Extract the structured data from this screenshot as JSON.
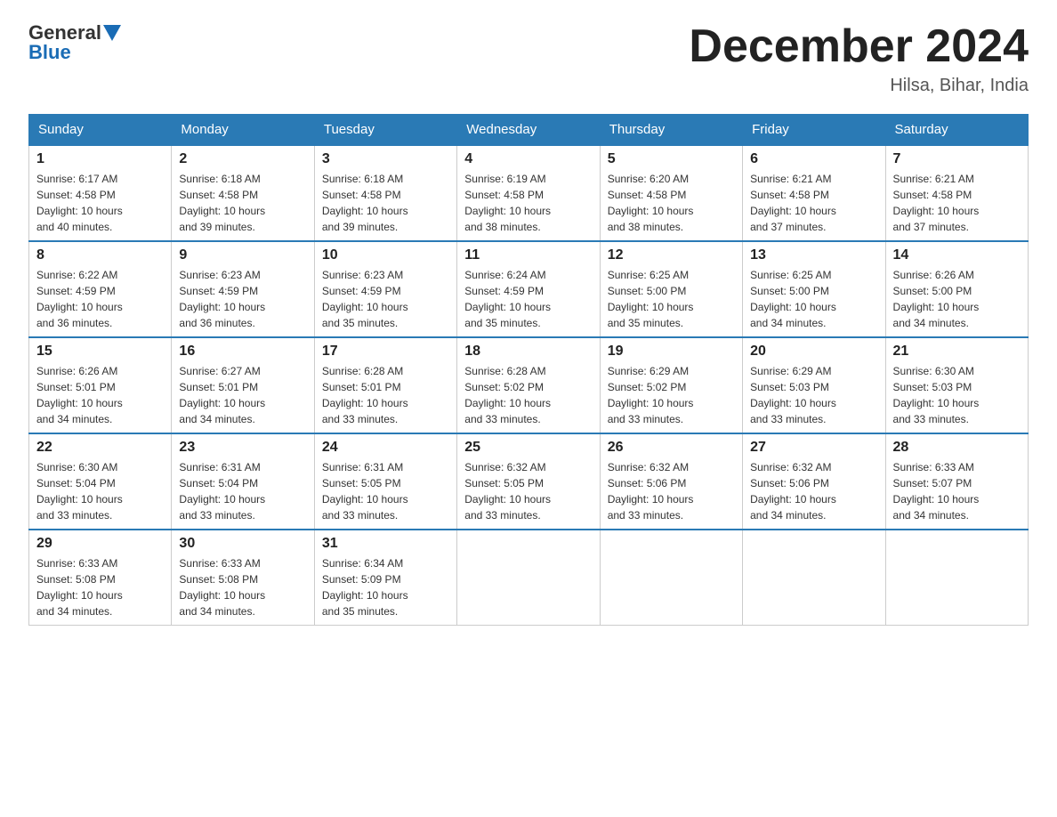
{
  "header": {
    "logo_general": "General",
    "logo_blue": "Blue",
    "month_title": "December 2024",
    "location": "Hilsa, Bihar, India"
  },
  "days_of_week": [
    "Sunday",
    "Monday",
    "Tuesday",
    "Wednesday",
    "Thursday",
    "Friday",
    "Saturday"
  ],
  "weeks": [
    [
      {
        "day": "1",
        "sunrise": "6:17 AM",
        "sunset": "4:58 PM",
        "daylight": "10 hours and 40 minutes."
      },
      {
        "day": "2",
        "sunrise": "6:18 AM",
        "sunset": "4:58 PM",
        "daylight": "10 hours and 39 minutes."
      },
      {
        "day": "3",
        "sunrise": "6:18 AM",
        "sunset": "4:58 PM",
        "daylight": "10 hours and 39 minutes."
      },
      {
        "day": "4",
        "sunrise": "6:19 AM",
        "sunset": "4:58 PM",
        "daylight": "10 hours and 38 minutes."
      },
      {
        "day": "5",
        "sunrise": "6:20 AM",
        "sunset": "4:58 PM",
        "daylight": "10 hours and 38 minutes."
      },
      {
        "day": "6",
        "sunrise": "6:21 AM",
        "sunset": "4:58 PM",
        "daylight": "10 hours and 37 minutes."
      },
      {
        "day": "7",
        "sunrise": "6:21 AM",
        "sunset": "4:58 PM",
        "daylight": "10 hours and 37 minutes."
      }
    ],
    [
      {
        "day": "8",
        "sunrise": "6:22 AM",
        "sunset": "4:59 PM",
        "daylight": "10 hours and 36 minutes."
      },
      {
        "day": "9",
        "sunrise": "6:23 AM",
        "sunset": "4:59 PM",
        "daylight": "10 hours and 36 minutes."
      },
      {
        "day": "10",
        "sunrise": "6:23 AM",
        "sunset": "4:59 PM",
        "daylight": "10 hours and 35 minutes."
      },
      {
        "day": "11",
        "sunrise": "6:24 AM",
        "sunset": "4:59 PM",
        "daylight": "10 hours and 35 minutes."
      },
      {
        "day": "12",
        "sunrise": "6:25 AM",
        "sunset": "5:00 PM",
        "daylight": "10 hours and 35 minutes."
      },
      {
        "day": "13",
        "sunrise": "6:25 AM",
        "sunset": "5:00 PM",
        "daylight": "10 hours and 34 minutes."
      },
      {
        "day": "14",
        "sunrise": "6:26 AM",
        "sunset": "5:00 PM",
        "daylight": "10 hours and 34 minutes."
      }
    ],
    [
      {
        "day": "15",
        "sunrise": "6:26 AM",
        "sunset": "5:01 PM",
        "daylight": "10 hours and 34 minutes."
      },
      {
        "day": "16",
        "sunrise": "6:27 AM",
        "sunset": "5:01 PM",
        "daylight": "10 hours and 34 minutes."
      },
      {
        "day": "17",
        "sunrise": "6:28 AM",
        "sunset": "5:01 PM",
        "daylight": "10 hours and 33 minutes."
      },
      {
        "day": "18",
        "sunrise": "6:28 AM",
        "sunset": "5:02 PM",
        "daylight": "10 hours and 33 minutes."
      },
      {
        "day": "19",
        "sunrise": "6:29 AM",
        "sunset": "5:02 PM",
        "daylight": "10 hours and 33 minutes."
      },
      {
        "day": "20",
        "sunrise": "6:29 AM",
        "sunset": "5:03 PM",
        "daylight": "10 hours and 33 minutes."
      },
      {
        "day": "21",
        "sunrise": "6:30 AM",
        "sunset": "5:03 PM",
        "daylight": "10 hours and 33 minutes."
      }
    ],
    [
      {
        "day": "22",
        "sunrise": "6:30 AM",
        "sunset": "5:04 PM",
        "daylight": "10 hours and 33 minutes."
      },
      {
        "day": "23",
        "sunrise": "6:31 AM",
        "sunset": "5:04 PM",
        "daylight": "10 hours and 33 minutes."
      },
      {
        "day": "24",
        "sunrise": "6:31 AM",
        "sunset": "5:05 PM",
        "daylight": "10 hours and 33 minutes."
      },
      {
        "day": "25",
        "sunrise": "6:32 AM",
        "sunset": "5:05 PM",
        "daylight": "10 hours and 33 minutes."
      },
      {
        "day": "26",
        "sunrise": "6:32 AM",
        "sunset": "5:06 PM",
        "daylight": "10 hours and 33 minutes."
      },
      {
        "day": "27",
        "sunrise": "6:32 AM",
        "sunset": "5:06 PM",
        "daylight": "10 hours and 34 minutes."
      },
      {
        "day": "28",
        "sunrise": "6:33 AM",
        "sunset": "5:07 PM",
        "daylight": "10 hours and 34 minutes."
      }
    ],
    [
      {
        "day": "29",
        "sunrise": "6:33 AM",
        "sunset": "5:08 PM",
        "daylight": "10 hours and 34 minutes."
      },
      {
        "day": "30",
        "sunrise": "6:33 AM",
        "sunset": "5:08 PM",
        "daylight": "10 hours and 34 minutes."
      },
      {
        "day": "31",
        "sunrise": "6:34 AM",
        "sunset": "5:09 PM",
        "daylight": "10 hours and 35 minutes."
      },
      null,
      null,
      null,
      null
    ]
  ],
  "labels": {
    "sunrise": "Sunrise:",
    "sunset": "Sunset:",
    "daylight": "Daylight:"
  }
}
